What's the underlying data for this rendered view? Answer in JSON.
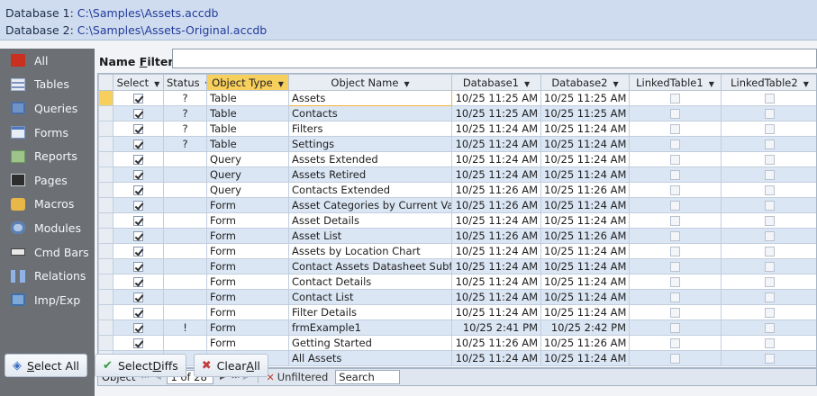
{
  "header": {
    "db1_label": "Database 1:",
    "db1_path": "C:\\Samples\\Assets.accdb",
    "db2_label": "Database 2:",
    "db2_path": "C:\\Samples\\Assets-Original.accdb"
  },
  "sidebar": {
    "items": [
      {
        "label": "All",
        "icon": "all-icon"
      },
      {
        "label": "Tables",
        "icon": "tables-icon"
      },
      {
        "label": "Queries",
        "icon": "queries-icon"
      },
      {
        "label": "Forms",
        "icon": "forms-icon"
      },
      {
        "label": "Reports",
        "icon": "reports-icon"
      },
      {
        "label": "Pages",
        "icon": "pages-icon"
      },
      {
        "label": "Macros",
        "icon": "macros-icon"
      },
      {
        "label": "Modules",
        "icon": "modules-icon"
      },
      {
        "label": "Cmd Bars",
        "icon": "cmd-bars-icon"
      },
      {
        "label": "Relations",
        "icon": "relations-icon"
      },
      {
        "label": "Imp/Exp",
        "icon": "imp-exp-icon"
      }
    ]
  },
  "filter": {
    "label_pre": "Name ",
    "label_ul": "F",
    "label_post": "ilter:",
    "value": ""
  },
  "grid": {
    "columns": [
      "Select",
      "Status",
      "Object Type",
      "Object Name",
      "Database1",
      "Database2",
      "LinkedTable1",
      "LinkedTable2"
    ],
    "rows": [
      {
        "select": true,
        "status": "?",
        "type": "Table",
        "name": "Assets",
        "db1": "10/25 11:25 AM",
        "db2": "10/25 11:25 AM"
      },
      {
        "select": true,
        "status": "?",
        "type": "Table",
        "name": "Contacts",
        "db1": "10/25 11:25 AM",
        "db2": "10/25 11:25 AM"
      },
      {
        "select": true,
        "status": "?",
        "type": "Table",
        "name": "Filters",
        "db1": "10/25 11:24 AM",
        "db2": "10/25 11:24 AM"
      },
      {
        "select": true,
        "status": "?",
        "type": "Table",
        "name": "Settings",
        "db1": "10/25 11:24 AM",
        "db2": "10/25 11:24 AM"
      },
      {
        "select": true,
        "status": "",
        "type": "Query",
        "name": "Assets Extended",
        "db1": "10/25 11:24 AM",
        "db2": "10/25 11:24 AM"
      },
      {
        "select": true,
        "status": "",
        "type": "Query",
        "name": "Assets Retired",
        "db1": "10/25 11:24 AM",
        "db2": "10/25 11:24 AM"
      },
      {
        "select": true,
        "status": "",
        "type": "Query",
        "name": "Contacts Extended",
        "db1": "10/25 11:26 AM",
        "db2": "10/25 11:26 AM"
      },
      {
        "select": true,
        "status": "",
        "type": "Form",
        "name": "Asset Categories by Current Value",
        "db1": "10/25 11:26 AM",
        "db2": "10/25 11:24 AM"
      },
      {
        "select": true,
        "status": "",
        "type": "Form",
        "name": "Asset Details",
        "db1": "10/25 11:24 AM",
        "db2": "10/25 11:24 AM"
      },
      {
        "select": true,
        "status": "",
        "type": "Form",
        "name": "Asset List",
        "db1": "10/25 11:26 AM",
        "db2": "10/25 11:26 AM"
      },
      {
        "select": true,
        "status": "",
        "type": "Form",
        "name": "Assets by Location Chart",
        "db1": "10/25 11:24 AM",
        "db2": "10/25 11:24 AM"
      },
      {
        "select": true,
        "status": "",
        "type": "Form",
        "name": "Contact Assets Datasheet Subform",
        "db1": "10/25 11:24 AM",
        "db2": "10/25 11:24 AM"
      },
      {
        "select": true,
        "status": "",
        "type": "Form",
        "name": "Contact Details",
        "db1": "10/25 11:24 AM",
        "db2": "10/25 11:24 AM"
      },
      {
        "select": true,
        "status": "",
        "type": "Form",
        "name": "Contact List",
        "db1": "10/25 11:24 AM",
        "db2": "10/25 11:24 AM"
      },
      {
        "select": true,
        "status": "",
        "type": "Form",
        "name": "Filter Details",
        "db1": "10/25 11:24 AM",
        "db2": "10/25 11:24 AM"
      },
      {
        "select": true,
        "status": "!",
        "type": "Form",
        "name": "frmExample1",
        "db1": "10/25 2:41 PM",
        "db2": "10/25 2:42 PM"
      },
      {
        "select": true,
        "status": "",
        "type": "Form",
        "name": "Getting Started",
        "db1": "10/25 11:26 AM",
        "db2": "10/25 11:26 AM"
      },
      {
        "select": true,
        "status": "",
        "type": "Report",
        "name": "All Assets",
        "db1": "10/25 11:24 AM",
        "db2": "10/25 11:24 AM"
      }
    ]
  },
  "nav": {
    "label": "Object",
    "position": "1 of 28",
    "filter_state": "Unfiltered",
    "search": "Search"
  },
  "buttons": {
    "select_all_pre": "",
    "select_all_ul": "S",
    "select_all_post": "elect All",
    "select_diffs_pre": "Select ",
    "select_diffs_ul": "D",
    "select_diffs_post": "iffs",
    "clear_all_pre": "Clear ",
    "clear_all_ul": "A",
    "clear_all_post": "ll"
  },
  "colors": {
    "header_bg": "#cfdcef",
    "sidebar_bg": "#6c7075",
    "active_header": "#f7cf5c",
    "row_alt": "#dbe6f4"
  }
}
